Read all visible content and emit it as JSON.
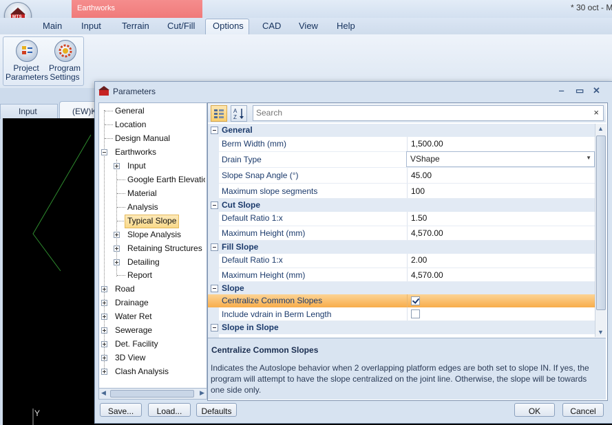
{
  "titlebar": {
    "context_tab": "Earthworks",
    "document_title": "* 30 oct - M"
  },
  "logo": {
    "text": "MTS"
  },
  "menu": {
    "items": [
      "Main",
      "Input",
      "Terrain",
      "Cut/Fill",
      "Options",
      "CAD",
      "View",
      "Help"
    ],
    "active": "Options"
  },
  "ribbon": {
    "project_parameters_l1": "Project",
    "project_parameters_l2": "Parameters",
    "program_settings_l1": "Program",
    "program_settings_l2": "Settings"
  },
  "doc_tabs": {
    "input": "Input",
    "ewk": "(EW)K"
  },
  "cad": {
    "y_axis_label": "Y"
  },
  "dialog": {
    "title": "Parameters",
    "tree": {
      "items": [
        "General",
        "Location",
        "Design Manual",
        "Earthworks",
        "Input",
        "Google Earth Elevation",
        "Material",
        "Analysis",
        "Typical Slope",
        "Slope Analysis",
        "Retaining Structures",
        "Detailing",
        "Report",
        "Road",
        "Drainage",
        "Water Ret",
        "Sewerage",
        "Det. Facility",
        "3D View",
        "Clash Analysis"
      ],
      "selected": "Typical Slope"
    },
    "search": {
      "placeholder": "Search",
      "clear": "×"
    },
    "categories": {
      "general": "General",
      "cut_slope": "Cut Slope",
      "fill_slope": "Fill Slope",
      "slope": "Slope",
      "slope_in_slope": "Slope in Slope"
    },
    "properties": {
      "berm_width": {
        "name": "Berm Width (mm)",
        "value": "1,500.00"
      },
      "drain_type": {
        "name": "Drain Type",
        "value": "VShape"
      },
      "snap_angle": {
        "name": "Slope Snap Angle (°)",
        "value": "45.00"
      },
      "max_segments": {
        "name": "Maximum slope segments",
        "value": "100"
      },
      "cut_ratio": {
        "name": "Default Ratio 1:x",
        "value": "1.50"
      },
      "cut_max_height": {
        "name": "Maximum Height (mm)",
        "value": "4,570.00"
      },
      "fill_ratio": {
        "name": "Default Ratio 1:x",
        "value": "2.00"
      },
      "fill_max_height": {
        "name": "Maximum Height (mm)",
        "value": "4,570.00"
      },
      "centralize": {
        "name": "Centralize Common Slopes",
        "checked": true
      },
      "include_vdrain": {
        "name": "Include vdrain in Berm Length",
        "checked": false
      }
    },
    "description": {
      "title": "Centralize Common Slopes",
      "text": "Indicates the Autoslope behavior when 2 overlapping platform edges are both set to slope IN. If yes, the program will attempt to have the slope centralized on the joint line. Otherwise, the slope will be towards one side only."
    },
    "buttons": {
      "save": "Save...",
      "load": "Load...",
      "defaults": "Defaults",
      "ok": "OK",
      "cancel": "Cancel"
    }
  }
}
